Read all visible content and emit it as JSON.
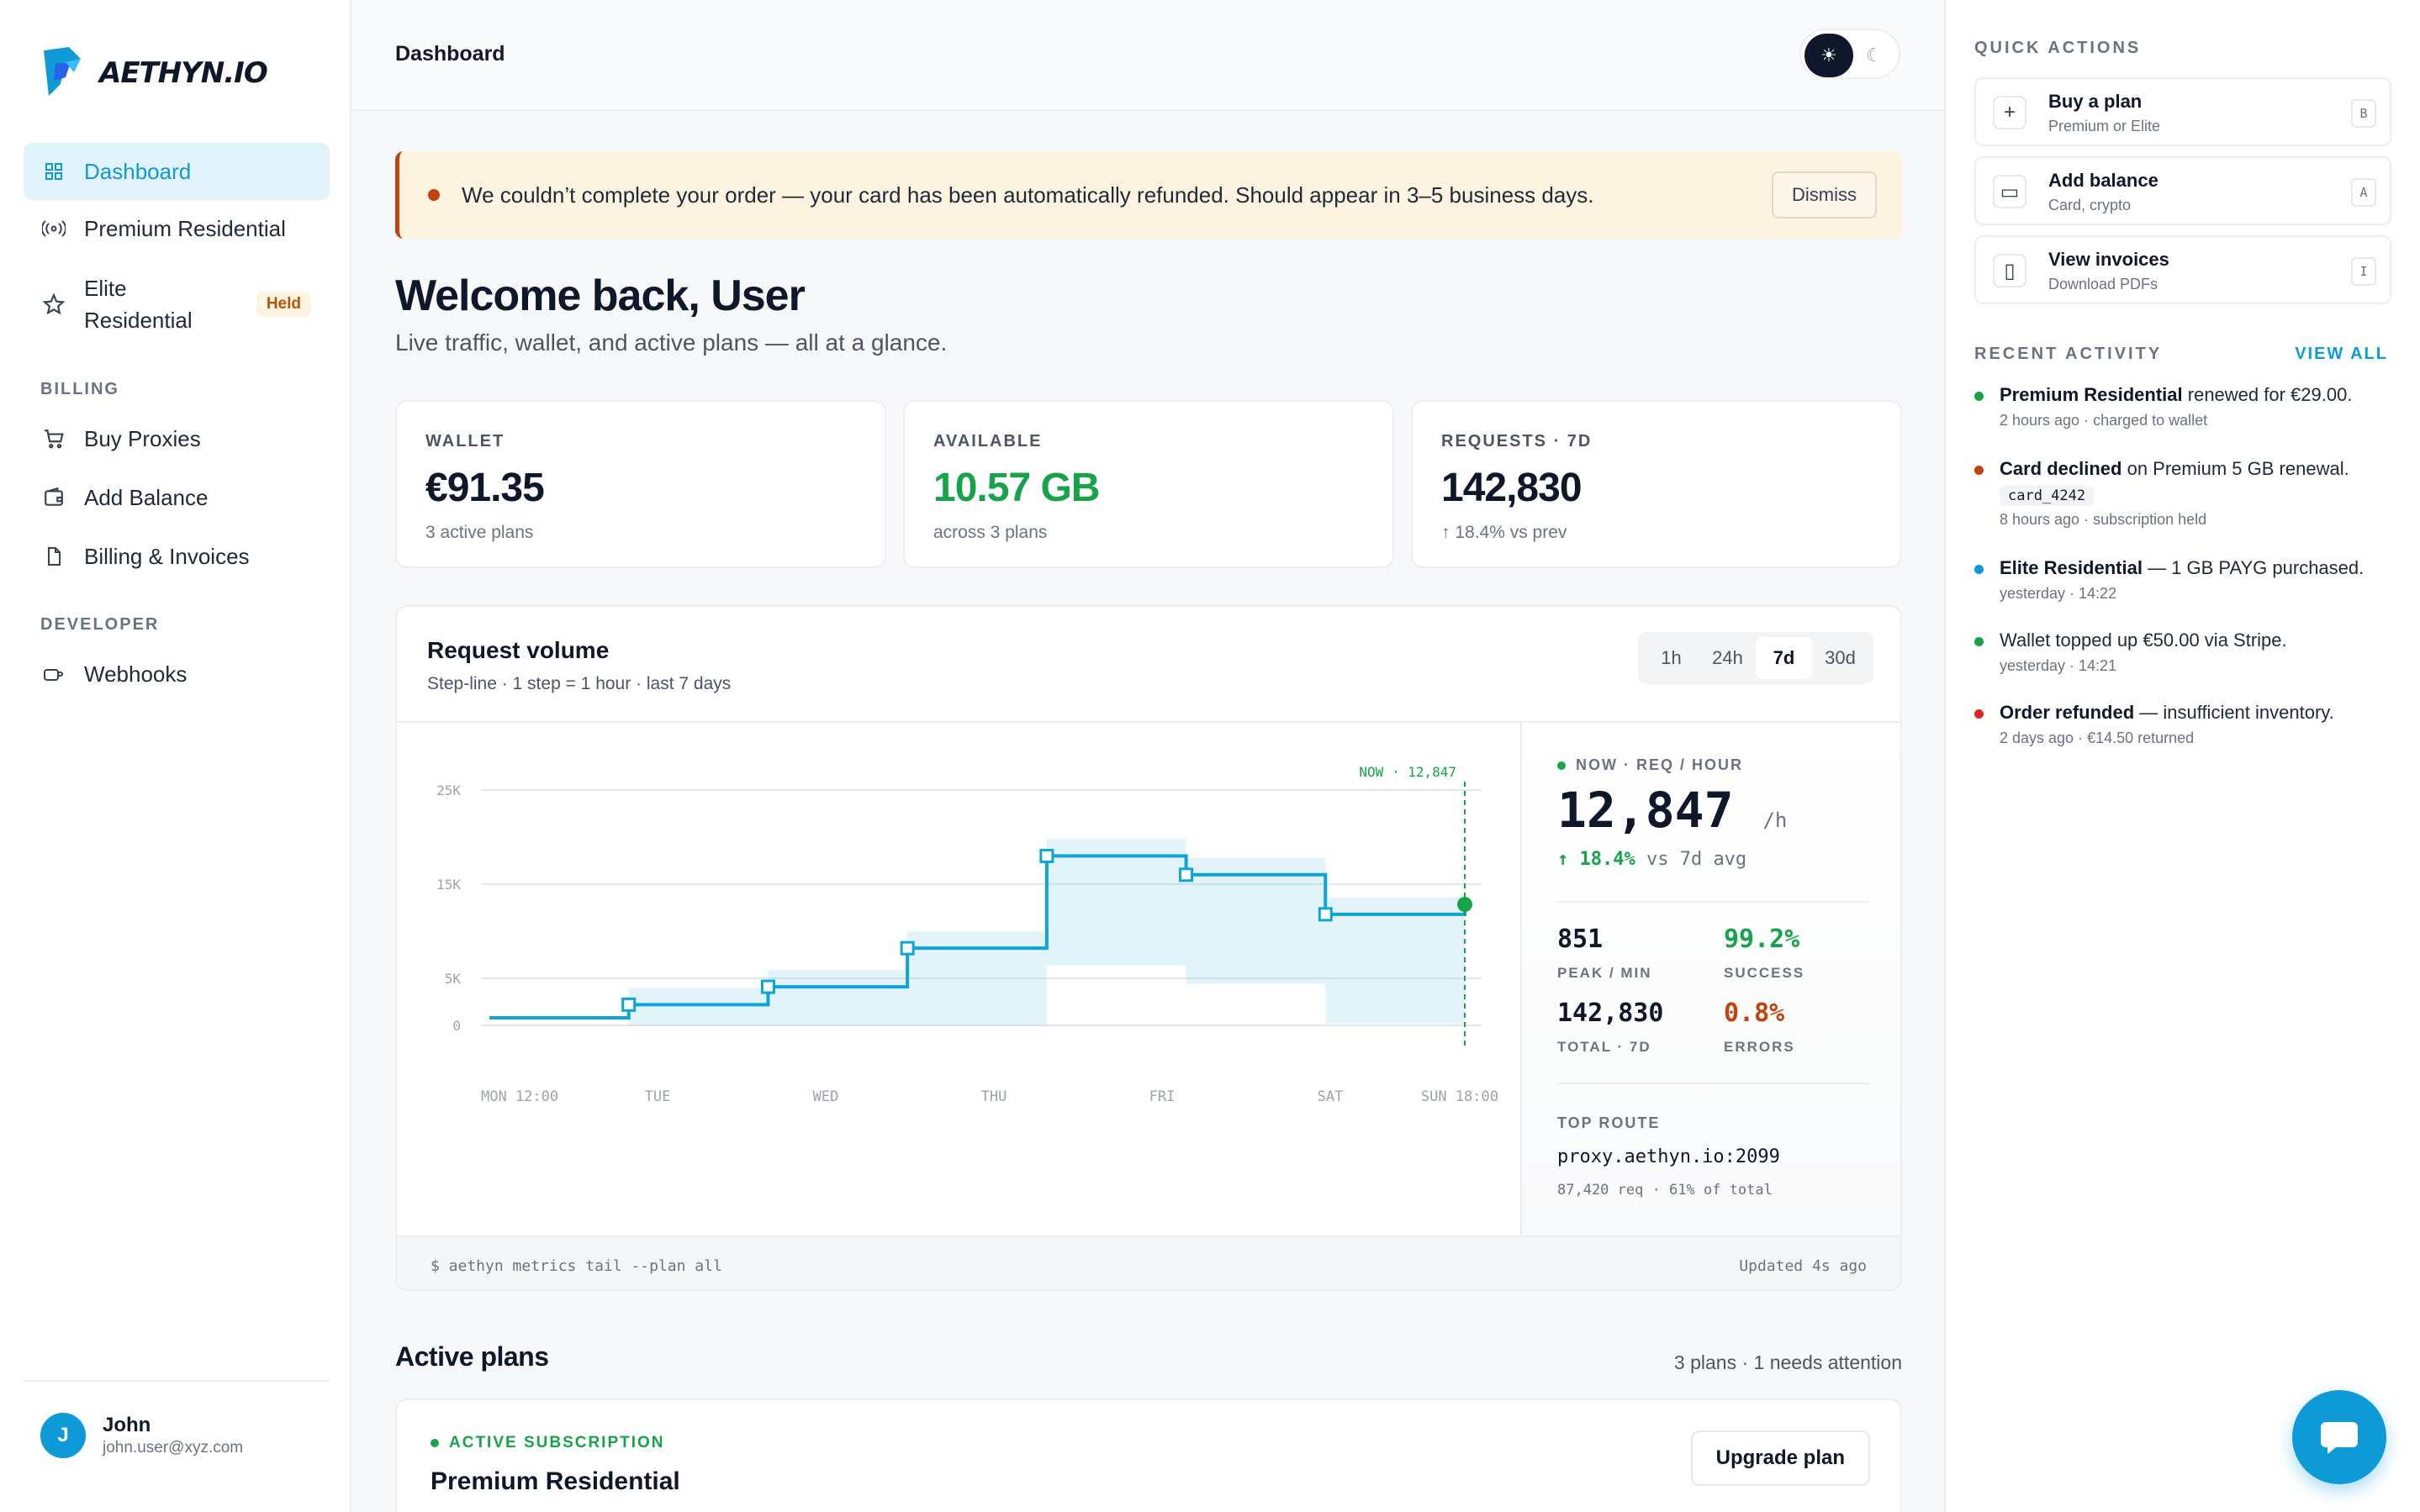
{
  "brand": {
    "name": "AETHYN.IO",
    "accent": "#0e9ad6"
  },
  "sidebar": {
    "nav": [
      {
        "label": "Dashboard",
        "icon": "grid-icon",
        "active": true
      },
      {
        "label": "Premium Residential",
        "icon": "broadcast-icon"
      },
      {
        "label": "Elite Residential",
        "icon": "star-icon",
        "badge": "Held"
      }
    ],
    "billing_heading": "BILLING",
    "billing": [
      {
        "label": "Buy Proxies",
        "icon": "cart-icon"
      },
      {
        "label": "Add Balance",
        "icon": "wallet-icon"
      },
      {
        "label": "Billing & Invoices",
        "icon": "document-icon"
      }
    ],
    "developer_heading": "DEVELOPER",
    "developer": [
      {
        "label": "Webhooks",
        "icon": "webhook-icon"
      }
    ],
    "user": {
      "initial": "J",
      "name": "John",
      "email": "john.user@xyz.com"
    }
  },
  "topbar": {
    "title": "Dashboard",
    "theme_light_icon": "☀",
    "theme_dark_icon": "☾"
  },
  "alert": {
    "text": "We couldn’t complete your order — your card has been automatically refunded. Should appear in 3–5 business days.",
    "dismiss_label": "Dismiss"
  },
  "welcome": {
    "title": "Welcome back, User",
    "subtitle": "Live traffic, wallet, and active plans — all at a glance."
  },
  "stats": [
    {
      "label": "WALLET",
      "value": "€91.35",
      "sub": "3 active plans"
    },
    {
      "label": "AVAILABLE",
      "value": "10.57 GB",
      "sub": "across 3 plans"
    },
    {
      "label": "REQUESTS · 7D",
      "value": "142,830",
      "sub": "↑ 18.4% vs prev"
    }
  ],
  "request_volume": {
    "title": "Request volume",
    "subtitle": "Step-line · 1 step = 1 hour · last 7 days",
    "ranges": [
      "1h",
      "24h",
      "7d",
      "30d"
    ],
    "active_range": "7d",
    "now_label": "NOW · REQ / HOUR",
    "now_value": "12,847",
    "now_unit": "/h",
    "delta": "↑ 18.4%",
    "delta_suffix": "vs 7d avg",
    "peak_value": "851",
    "peak_label": "PEAK / MIN",
    "success_value": "99.2%",
    "success_label": "SUCCESS",
    "total_value": "142,830",
    "total_label": "TOTAL · 7D",
    "errors_value": "0.8%",
    "errors_label": "ERRORS",
    "top_route_label": "TOP ROUTE",
    "top_route": "proxy.aethyn.io:2099",
    "top_route_meta": "87,420 req · 61% of total",
    "footer_cmd": "$ aethyn metrics tail --plan all",
    "footer_updated": "Updated 4s ago"
  },
  "chart_data": {
    "type": "line",
    "title": "Request volume",
    "step": true,
    "x": [
      "MON 12:00",
      "TUE",
      "WED",
      "THU",
      "FRI",
      "SAT",
      "SUN 18:00"
    ],
    "series": [
      {
        "values": [
          800,
          2200,
          4100,
          8200,
          18000,
          16000,
          11800,
          12847
        ]
      }
    ],
    "yticks": [
      "0",
      "5K",
      "15K",
      "25K"
    ],
    "ylim": [
      0,
      25000
    ],
    "now_marker": "NOW · 12,847",
    "line_color": "#0ea5d6"
  },
  "active_plans": {
    "title": "Active plans",
    "meta": "3 plans · 1 needs attention",
    "first": {
      "tag": "ACTIVE SUBSCRIPTION",
      "name": "Premium Residential",
      "button": "Upgrade plan"
    }
  },
  "quick_actions": {
    "heading": "QUICK ACTIONS",
    "items": [
      {
        "title": "Buy a plan",
        "sub": "Premium or Elite",
        "key": "B",
        "icon": "plus-icon",
        "glyph": "+"
      },
      {
        "title": "Add balance",
        "sub": "Card, crypto",
        "key": "A",
        "icon": "card-icon",
        "glyph": "▭"
      },
      {
        "title": "View invoices",
        "sub": "Download PDFs",
        "key": "I",
        "icon": "file-icon",
        "glyph": "▯"
      }
    ]
  },
  "recent_activity": {
    "heading": "RECENT ACTIVITY",
    "view_all": "VIEW ALL",
    "items": [
      {
        "bold": "Premium Residential",
        "text": " renewed for €29.00.",
        "meta": "2 hours ago · charged to wallet",
        "color": "#16a34a"
      },
      {
        "bold": "Card declined",
        "text": " on Premium 5 GB renewal.",
        "chip": "card_4242",
        "meta": "8 hours ago · subscription held",
        "color": "#c2410c"
      },
      {
        "bold": "Elite Residential",
        "text": " — 1 GB PAYG purchased.",
        "meta": "yesterday · 14:22",
        "color": "#0e9ad6"
      },
      {
        "bold": "",
        "text": "Wallet topped up €50.00 via Stripe.",
        "meta": "yesterday · 14:21",
        "color": "#16a34a"
      },
      {
        "bold": "Order refunded",
        "text": " — insufficient inventory.",
        "meta": "2 days ago · €14.50 returned",
        "color": "#dc2626"
      }
    ]
  }
}
